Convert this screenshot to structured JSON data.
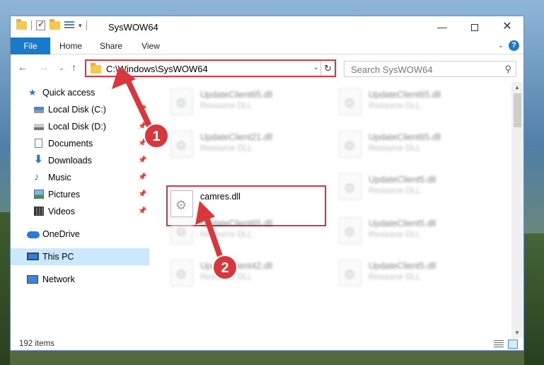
{
  "window": {
    "title": "SysWOW64",
    "min_glyph": "—",
    "close_glyph": "✕"
  },
  "ribbon": {
    "tabs": [
      "File",
      "Home",
      "Share",
      "View"
    ],
    "collapse_glyph": "⌄",
    "help_glyph": "?"
  },
  "nav": {
    "back_glyph": "←",
    "forward_glyph": "→",
    "recent_glyph": "⌄",
    "up_glyph": "↑",
    "address": "C:\\Windows\\SysWOW64",
    "address_dropdown_glyph": "⌄",
    "refresh_glyph": "↻",
    "search_placeholder": "Search SysWOW64",
    "search_glyph": "⚲"
  },
  "sidebar": {
    "items": [
      {
        "label": "Quick access",
        "icon": "star-icon"
      },
      {
        "label": "Local Disk (C:)",
        "icon": "disk-icon"
      },
      {
        "label": "Local Disk (D:)",
        "icon": "disk-icon"
      },
      {
        "label": "Documents",
        "icon": "documents-icon"
      },
      {
        "label": "Downloads",
        "icon": "download-icon"
      },
      {
        "label": "Music",
        "icon": "music-icon"
      },
      {
        "label": "Pictures",
        "icon": "pictures-icon"
      },
      {
        "label": "Videos",
        "icon": "videos-icon"
      },
      {
        "label": "OneDrive",
        "icon": "onedrive-icon"
      },
      {
        "label": "This PC",
        "icon": "this-pc-icon"
      },
      {
        "label": "Network",
        "icon": "network-icon"
      }
    ],
    "pin_glyph": "📌",
    "selected": "This PC"
  },
  "files": [
    {
      "name": "UpdateClient65.dll",
      "type": "Resource DLL"
    },
    {
      "name": "UpdateClient65.dll",
      "type": "Resource DLL"
    },
    {
      "name": "UpdateClient21.dll",
      "type": "Resource DLL"
    },
    {
      "name": "UpdateClient65.dll",
      "type": "Resource DLL"
    },
    {
      "name": "camres.dll",
      "type": ""
    },
    {
      "name": "UpdateClient5.dll",
      "type": "Resource DLL"
    },
    {
      "name": "UpdateClient65.dll",
      "type": "Resource DLL"
    },
    {
      "name": "UpdateClient5.dll",
      "type": "Resource DLL"
    },
    {
      "name": "UpdateClient42.dll",
      "type": "Resource DLL"
    },
    {
      "name": "UpdateClient5.dll",
      "type": "Resource DLL"
    }
  ],
  "status": {
    "item_count": "192 items"
  },
  "annotations": {
    "step1": "1",
    "step2": "2",
    "accent_red": "#d9363e"
  }
}
